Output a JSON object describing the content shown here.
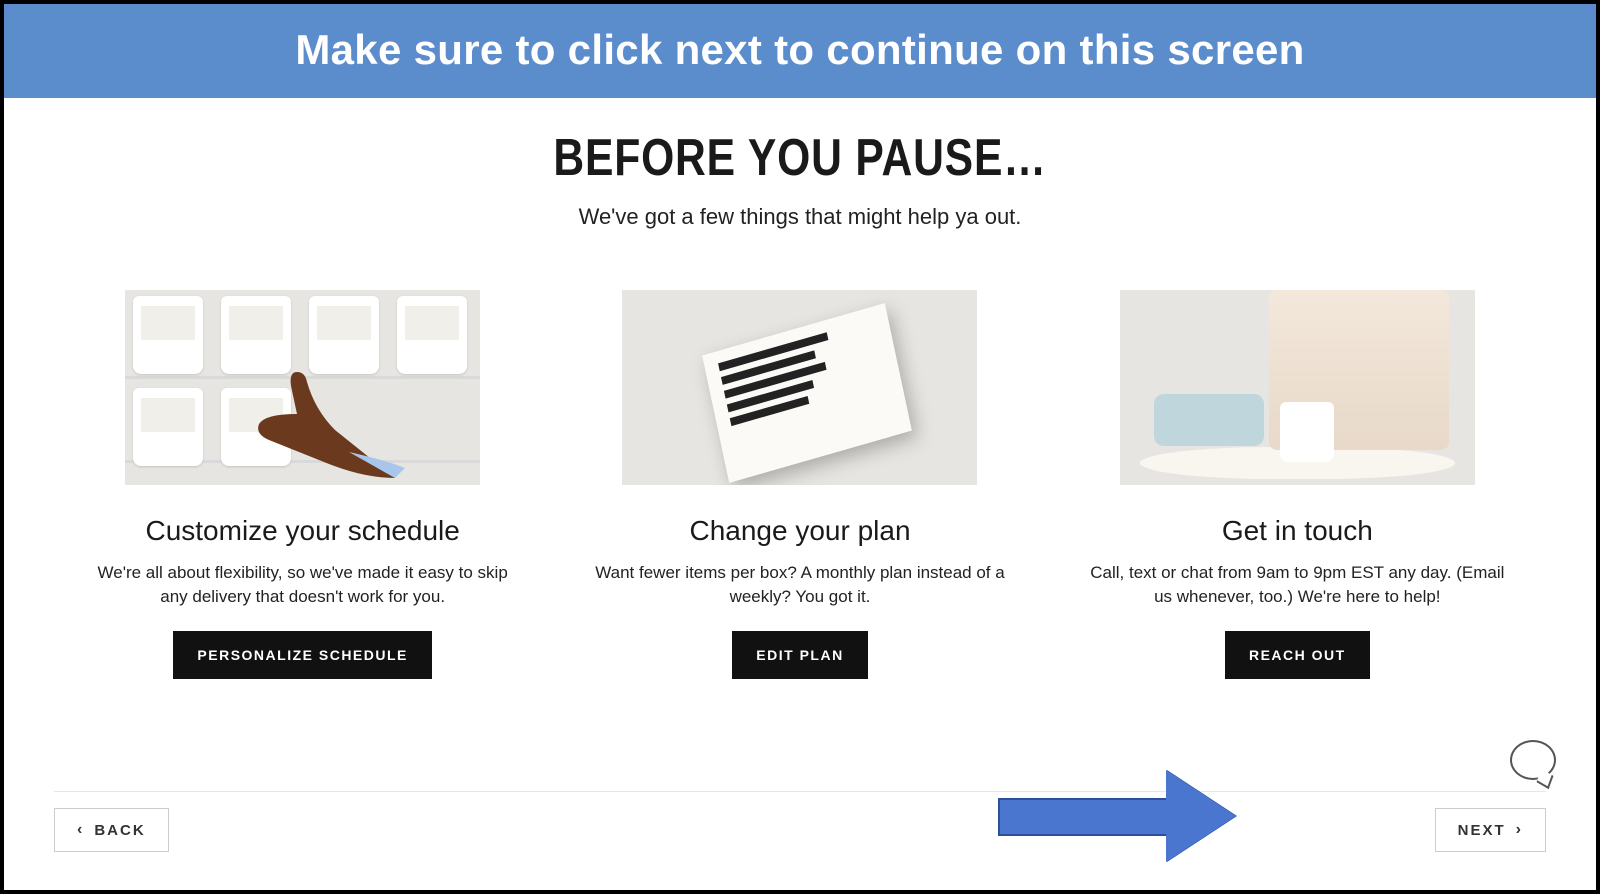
{
  "banner": {
    "text": "Make sure to click next to continue on this screen"
  },
  "header": {
    "title": "BEFORE YOU PAUSE…",
    "subtitle": "We've got a few things that might help ya out."
  },
  "cards": [
    {
      "title": "Customize your schedule",
      "desc": "We're all about flexibility, so we've made it easy to skip any delivery that doesn't work for you.",
      "cta": "PERSONALIZE SCHEDULE"
    },
    {
      "title": "Change your plan",
      "desc": "Want fewer items per box? A monthly plan instead of a weekly? You got it.",
      "cta": "EDIT PLAN"
    },
    {
      "title": "Get in touch",
      "desc": "Call, text or chat from 9am to 9pm EST any day. (Email us whenever, too.) We're here to help!",
      "cta": "REACH OUT"
    }
  ],
  "nav": {
    "back": "BACK",
    "next": "NEXT"
  }
}
